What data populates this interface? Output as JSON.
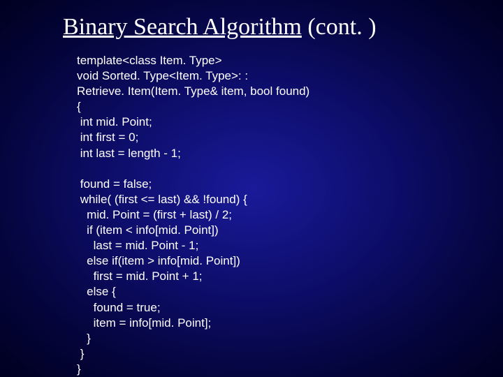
{
  "title": {
    "underlined": "Binary Search Algorithm",
    "rest": " (cont. )"
  },
  "code": {
    "l01": "template<class Item. Type>",
    "l02": "void Sorted. Type<Item. Type>: :",
    "l03": "Retrieve. Item(Item. Type& item, bool found)",
    "l04": "{",
    "l05": " int mid. Point;",
    "l06": " int first = 0;",
    "l07": " int last = length - 1;",
    "l08": "",
    "l09": " found = false;",
    "l10": " while( (first <= last) && !found) {",
    "l11": "   mid. Point = (first + last) / 2;",
    "l12": "   if (item < info[mid. Point])",
    "l13": "     last = mid. Point - 1;",
    "l14": "   else if(item > info[mid. Point])",
    "l15": "     first = mid. Point + 1;",
    "l16": "   else {",
    "l17": "     found = true;",
    "l18": "     item = info[mid. Point];",
    "l19": "   }",
    "l20": " }",
    "l21": "}"
  }
}
